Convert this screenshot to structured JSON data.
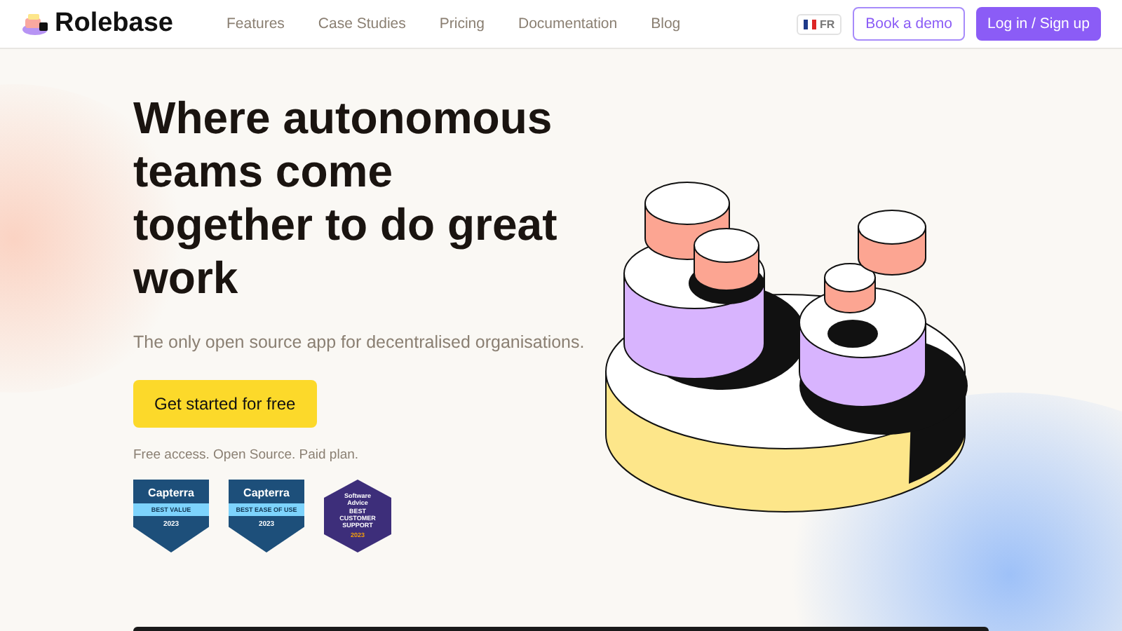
{
  "nav": {
    "brand": "Rolebase",
    "links": [
      "Features",
      "Case Studies",
      "Pricing",
      "Documentation",
      "Blog"
    ],
    "language": "FR",
    "demo_button": "Book a demo",
    "login_button": "Log in / Sign up"
  },
  "hero": {
    "title": "Where autonomous teams come together to do great work",
    "subtitle": "The only open source app for decentralised organisations.",
    "cta": "Get started for free",
    "note": "Free access. Open Source. Paid plan."
  },
  "badges": [
    {
      "kind": "shield",
      "brand": "Capterra",
      "award": "BEST VALUE",
      "year": "2023"
    },
    {
      "kind": "shield",
      "brand": "Capterra",
      "award": "BEST EASE OF USE",
      "year": "2023"
    },
    {
      "kind": "hexagon",
      "brand": "Software Advice",
      "award": "BEST CUSTOMER SUPPORT",
      "year": "2023"
    }
  ]
}
